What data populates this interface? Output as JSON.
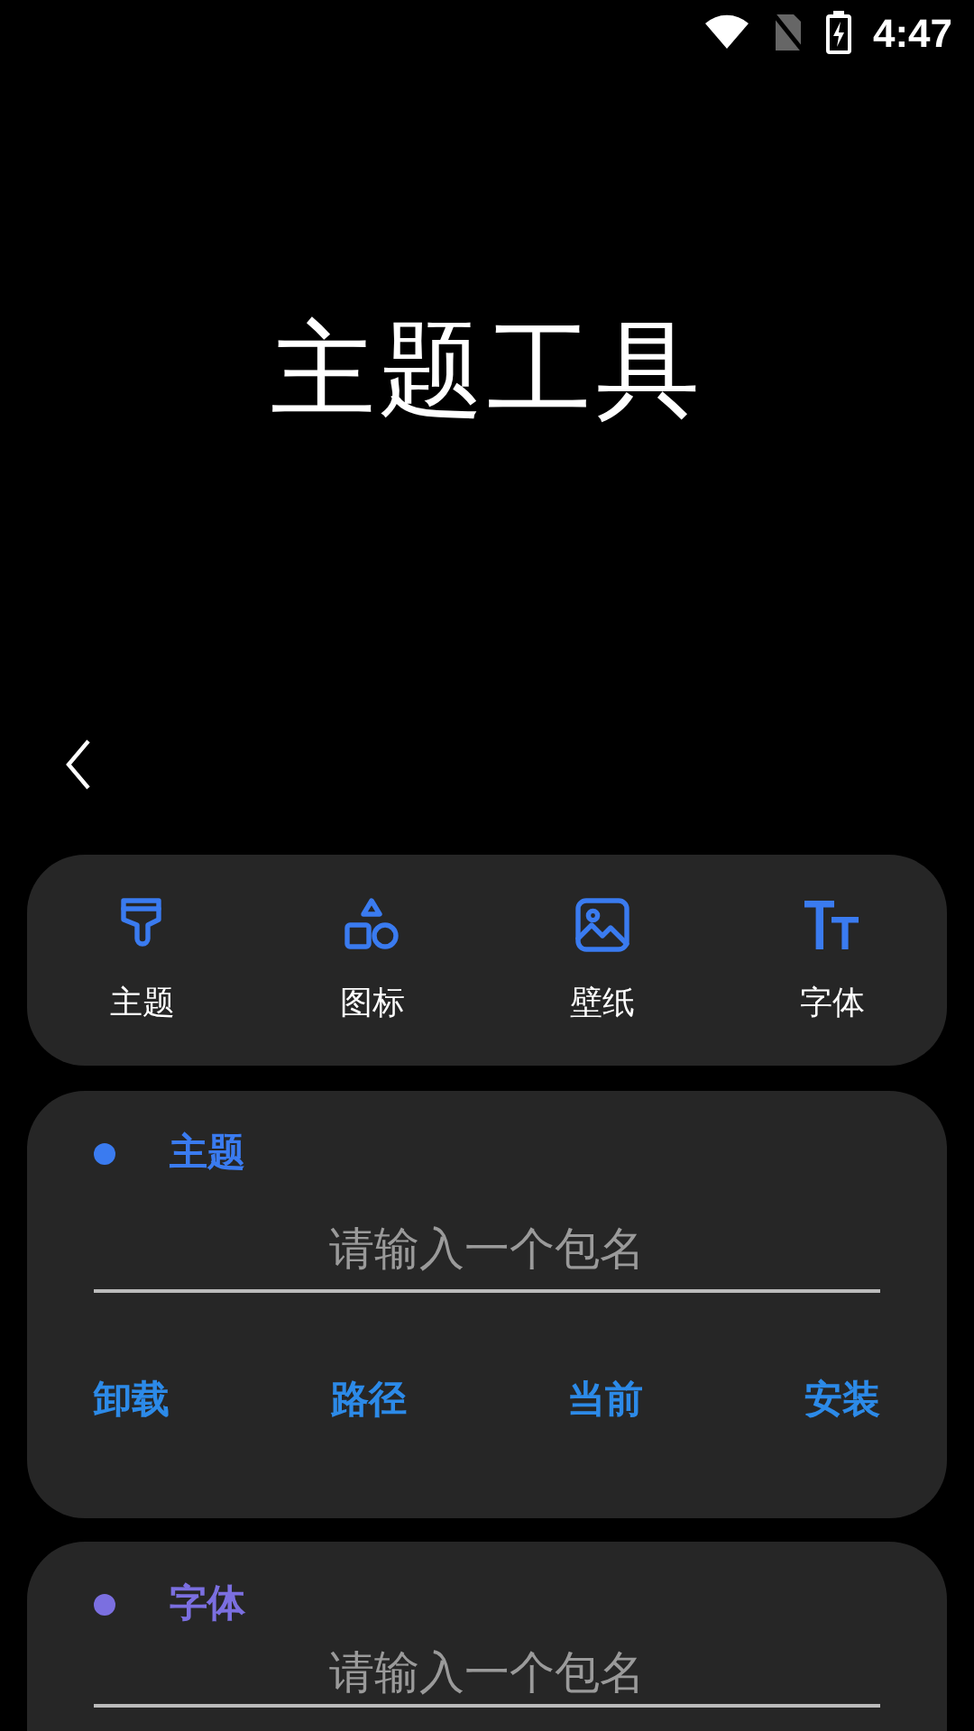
{
  "status_bar": {
    "time": "4:47"
  },
  "title": "主题工具",
  "nav": [
    {
      "kind": "brush",
      "label": "主题"
    },
    {
      "kind": "shapes",
      "label": "图标"
    },
    {
      "kind": "image",
      "label": "壁纸"
    },
    {
      "kind": "font",
      "label": "字体"
    }
  ],
  "sections": [
    {
      "title": "主题",
      "color": "#3a7bf0",
      "placeholder": "请输入一个包名",
      "actions": [
        "卸载",
        "路径",
        "当前",
        "安装"
      ]
    },
    {
      "title": "字体",
      "color": "#7b6fe0",
      "placeholder": "请输入一个包名"
    }
  ]
}
